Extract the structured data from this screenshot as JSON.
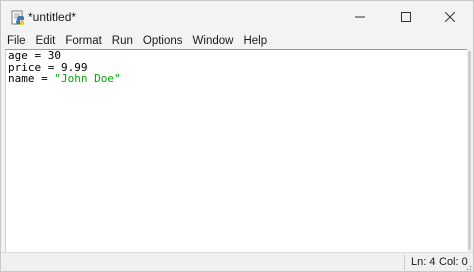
{
  "window": {
    "title": "*untitled*"
  },
  "menu": {
    "items": [
      {
        "label": "File"
      },
      {
        "label": "Edit"
      },
      {
        "label": "Format"
      },
      {
        "label": "Run"
      },
      {
        "label": "Options"
      },
      {
        "label": "Window"
      },
      {
        "label": "Help"
      }
    ]
  },
  "editor": {
    "lines": [
      {
        "code": "age = 30",
        "string_part": ""
      },
      {
        "code": "price = 9.99",
        "string_part": ""
      },
      {
        "code": "name = ",
        "string_part": "\"John Doe\""
      }
    ],
    "string_color": "#00aa00"
  },
  "status": {
    "line": "Ln: 4",
    "col": "Col: 0"
  },
  "icons": {
    "app": "idle-python-icon",
    "minimize": "minimize-icon",
    "maximize": "maximize-icon",
    "close": "close-icon"
  }
}
